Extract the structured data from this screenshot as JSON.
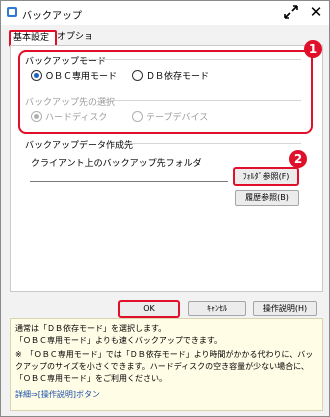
{
  "window": {
    "title": "バックアップ"
  },
  "tabs": [
    {
      "label": "基本設定"
    },
    {
      "label": "オプション"
    }
  ],
  "backup_mode": {
    "label": "バックアップモード",
    "options": [
      {
        "label": "ＯＢＣ専用モード",
        "selected": true
      },
      {
        "label": "ＤＢ依存モード",
        "selected": false
      }
    ]
  },
  "backup_dest": {
    "label": "バックアップ先の選択",
    "options": [
      {
        "label": "ハードディスク",
        "selected": true
      },
      {
        "label": "テープデバイス",
        "selected": false
      }
    ]
  },
  "backup_target": {
    "label": "バックアップデータ作成先",
    "folder_label": "クライアント上のバックアップ先フォルダ",
    "folder_value": "",
    "browse_button": "ﾌｫﾙﾀﾞ参照(F)",
    "history_button": "履歴参照(B)"
  },
  "badges": [
    "1",
    "2"
  ],
  "footer": {
    "ok": "OK",
    "cancel": "ｷｬﾝｾﾙ",
    "manual": "操作説明(H)"
  },
  "help": {
    "line1": "通常は「ＤＢ依存モード」を選択します。",
    "line2": "「ＯＢＣ専用モード」よりも速くバックアップできます。",
    "line3": "※　「ＯＢＣ専用モード」では「ＤＢ依存モード」より時間がかかる代わりに、バックアップのサイズを小さくできます。ハードディスクの空き容量が少ない場合に、「ＯＢＣ専用モード」をご利用ください。",
    "line4": "詳細⇒[操作説明]ボタン"
  },
  "colors": {
    "highlight": "#e0102a",
    "accent": "#1b63c9",
    "help_bg": "#fffde6"
  }
}
